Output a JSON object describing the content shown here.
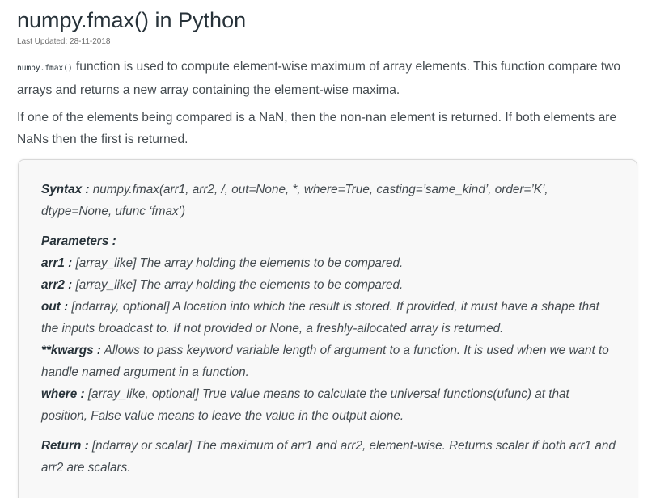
{
  "article": {
    "title": "numpy.fmax() in Python",
    "last_updated": "Last Updated: 28-11-2018"
  },
  "intro": {
    "code": "numpy.fmax()",
    "text": " function is used to compute element-wise maximum of array elements. This function compare two arrays and returns a new array containing the element-wise maxima.",
    "nan_note": "If one of the elements being compared is a NaN, then the non-nan element is returned. If both elements are NaNs then the first is returned."
  },
  "syntax": {
    "label": "Syntax :",
    "text": " numpy.fmax(arr1, arr2, /, out=None, *, where=True, casting=’same_kind’, order=’K’, dtype=None, ufunc ‘fmax’)"
  },
  "parameters": {
    "heading": "Parameters :",
    "items": [
      {
        "name": "arr1 :",
        "desc": " [array_like] The array holding the elements to be compared."
      },
      {
        "name": "arr2 :",
        "desc": " [array_like] The array holding the elements to be compared."
      },
      {
        "name": "out :",
        "desc": " [ndarray, optional] A location into which the result is stored. If provided, it must have a shape that the inputs broadcast to. If not provided or None, a freshly-allocated array is returned."
      },
      {
        "name": "**kwargs :",
        "desc": " Allows to pass keyword variable length of argument to a function. It is used when we want to handle named argument in a function."
      },
      {
        "name": "where :",
        "desc": " [array_like, optional] True value means to calculate the universal functions(ufunc) at that position, False value means to leave the value in the output alone."
      }
    ]
  },
  "return": {
    "label": "Return :",
    "text": " [ndarray or scalar] The maximum of arr1 and arr2, element-wise. Returns scalar if both arr1 and arr2 are scalars."
  }
}
